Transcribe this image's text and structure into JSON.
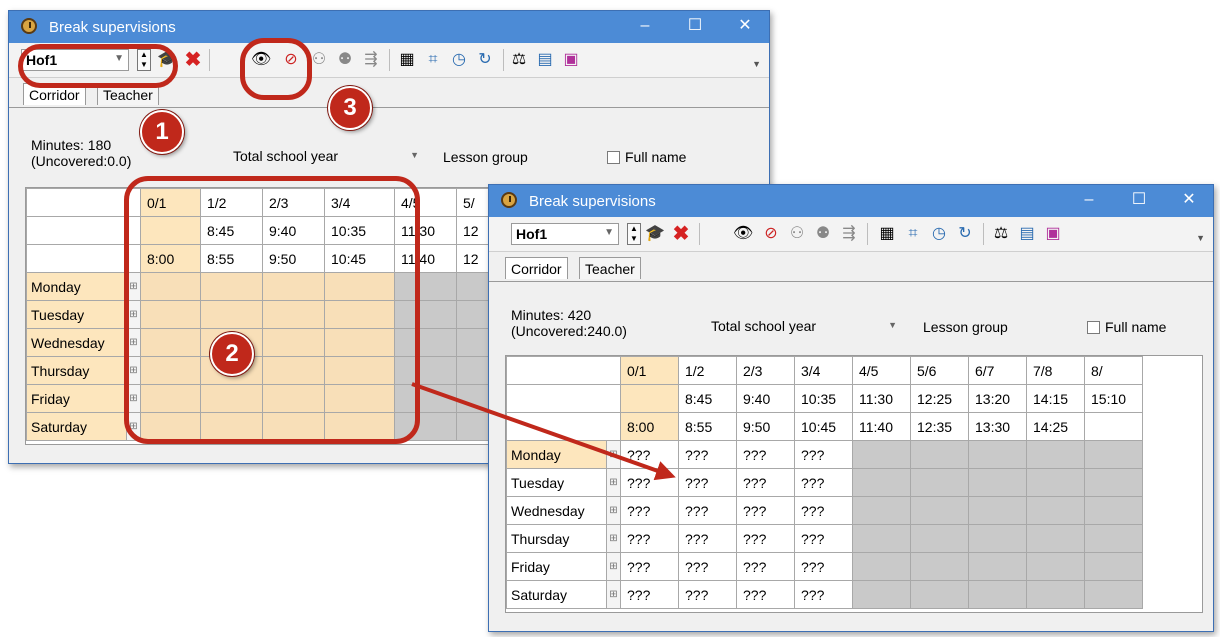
{
  "window1": {
    "title": "Break supervisions",
    "minimize": "–",
    "maximize": "☐",
    "close": "✕",
    "room_select": "Hof1",
    "tabs": [
      "Corridor",
      "Teacher"
    ],
    "minutes_line1": "Minutes: 180",
    "minutes_line2": "(Uncovered:0.0)",
    "period_select": "Total school year",
    "lesson_group": "Lesson group",
    "full_name": "Full name",
    "columns": [
      "0/1",
      "1/2",
      "2/3",
      "3/4",
      "4/5",
      "5/"
    ],
    "start_times": [
      "",
      "8:45",
      "9:40",
      "10:35",
      "11:30",
      "12"
    ],
    "end_times": [
      "8:00",
      "8:55",
      "9:50",
      "10:45",
      "11:40",
      "12"
    ],
    "days": [
      "Monday",
      "Tuesday",
      "Wednesday",
      "Thursday",
      "Friday",
      "Saturday"
    ]
  },
  "window2": {
    "title": "Break supervisions",
    "minimize": "–",
    "maximize": "☐",
    "close": "✕",
    "room_select": "Hof1",
    "tabs": [
      "Corridor",
      "Teacher"
    ],
    "minutes_line1": "Minutes: 420",
    "minutes_line2": "(Uncovered:240.0)",
    "period_select": "Total school year",
    "lesson_group": "Lesson group",
    "full_name": "Full name",
    "columns": [
      "0/1",
      "1/2",
      "2/3",
      "3/4",
      "4/5",
      "5/6",
      "6/7",
      "7/8",
      "8/"
    ],
    "start_times": [
      "",
      "8:45",
      "9:40",
      "10:35",
      "11:30",
      "12:25",
      "13:20",
      "14:15",
      "15:10"
    ],
    "end_times": [
      "8:00",
      "8:55",
      "9:50",
      "10:45",
      "11:40",
      "12:35",
      "13:30",
      "14:25",
      ""
    ],
    "days": [
      "Monday",
      "Tuesday",
      "Wednesday",
      "Thursday",
      "Friday",
      "Saturday"
    ],
    "cell_value": "???"
  },
  "toolbar_icons": [
    "teacher-hat-icon",
    "delete-icon",
    "eye-icon",
    "eye-crossed-icon",
    "people-icon",
    "people2-icon",
    "assign-icon",
    "calculator-icon",
    "crop-icon",
    "clock-icon",
    "refresh-icon",
    "scales-icon",
    "report-icon",
    "user-filter-icon"
  ],
  "callouts": [
    "1",
    "2",
    "3"
  ],
  "colors": {
    "accent": "#4c8bd6",
    "callout": "#c0281b",
    "day_cell": "#fde6bd",
    "gray_cell": "#c9c9c9"
  }
}
